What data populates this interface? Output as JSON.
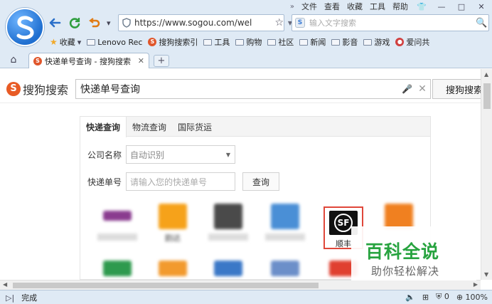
{
  "menubar": {
    "items": [
      "文件",
      "查看",
      "收藏",
      "工具",
      "帮助"
    ]
  },
  "address": {
    "url": "https://www.sogou.com/wel"
  },
  "search_box": {
    "placeholder": "输入文字搜索"
  },
  "bookmarks": {
    "favorites_label": "收藏",
    "items": [
      "Lenovo Rec",
      "搜狗搜索引",
      "工具",
      "购物",
      "社区",
      "新闻",
      "影音",
      "游戏",
      "爱问共"
    ]
  },
  "tab": {
    "title": "快递单号查询 - 搜狗搜索"
  },
  "sogou": {
    "brand": "搜狗搜索",
    "query": "快递单号查询",
    "search_button": "搜狗搜索"
  },
  "card": {
    "tabs": [
      "快递查询",
      "物流查询",
      "国际货运"
    ],
    "company_label": "公司名称",
    "company_value": "自动识别",
    "number_label": "快递单号",
    "number_placeholder": "请输入您的快递单号",
    "query_button": "查询",
    "logos": [
      {
        "name": "",
        "color": "#8a3b8f"
      },
      {
        "name": "韵达",
        "color": "#f6a21a"
      },
      {
        "name": "",
        "color": "#4a4a4a"
      },
      {
        "name": "",
        "color": "#4a8fd6"
      },
      {
        "name": "顺丰",
        "color": "#111111"
      },
      {
        "name": "",
        "color": "#f08020"
      }
    ]
  },
  "watermark": {
    "title": "百科全说",
    "subtitle": "助你轻松解决"
  },
  "status": {
    "text": "完成",
    "zoom": "100%",
    "count": "0"
  }
}
